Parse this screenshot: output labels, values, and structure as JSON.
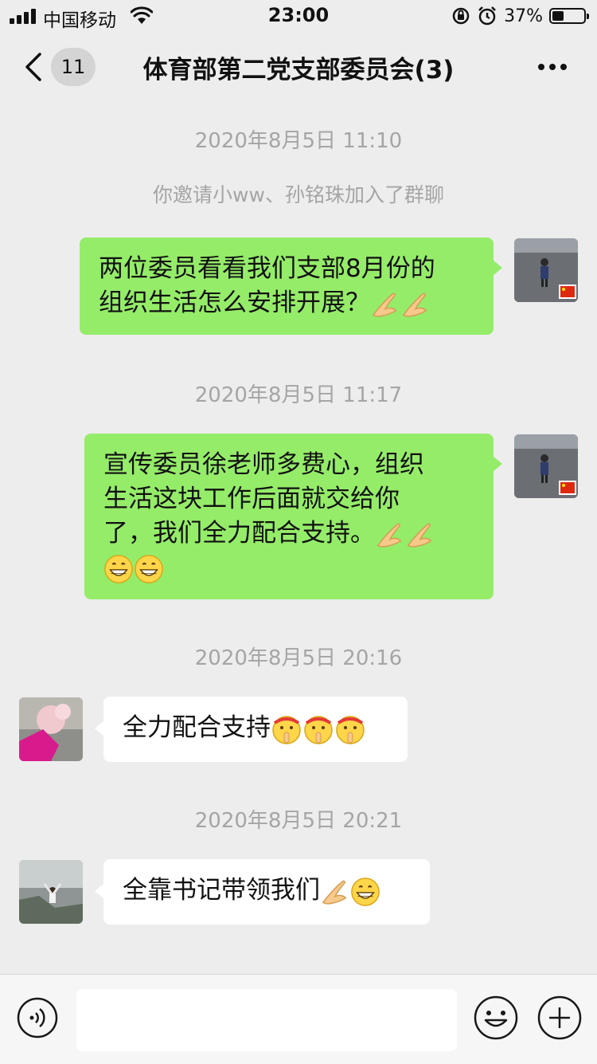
{
  "status_bar": {
    "carrier": "中国移动",
    "time": "23:00",
    "battery": "37%",
    "battery_level": 0.37
  },
  "nav": {
    "back_badge": "11",
    "title": "体育部第二党支部委员会(3)"
  },
  "messages": [
    {
      "type": "time",
      "text": "2020年8月5日 11:10"
    },
    {
      "type": "system",
      "text": "你邀请小ww、孙铭珠加入了群聊"
    },
    {
      "type": "me",
      "lines": [
        "两位委员看看我们支部8月份的",
        "组织生活怎么安排开展？"
      ],
      "emojis": [
        "clap-hands-icon",
        "clap-hands-icon"
      ]
    },
    {
      "type": "time",
      "text": "2020年8月5日 11:17"
    },
    {
      "type": "me",
      "lines": [
        "宣传委员徐老师多费心，组织",
        "生活这块工作后面就交给你",
        "了，我们全力配合支持。"
      ],
      "emojis": [
        "clap-hands-icon",
        "clap-hands-icon",
        "grin-icon",
        "grin-icon"
      ]
    },
    {
      "type": "time",
      "text": "2020年8月5日 20:16"
    },
    {
      "type": "other",
      "text": "全力配合支持",
      "emojis": [
        "shush-face-icon",
        "shush-face-icon",
        "shush-face-icon"
      ]
    },
    {
      "type": "time",
      "text": "2020年8月5日 20:21"
    },
    {
      "type": "other",
      "text": "全靠书记带领我们",
      "emojis": [
        "clap-hands-icon",
        "grin-icon"
      ]
    }
  ],
  "input": {
    "placeholder": ""
  },
  "colors": {
    "background": "#ededed",
    "my_bubble": "#95ec69",
    "other_bubble": "#ffffff",
    "timestamp": "#a5a5a5"
  }
}
